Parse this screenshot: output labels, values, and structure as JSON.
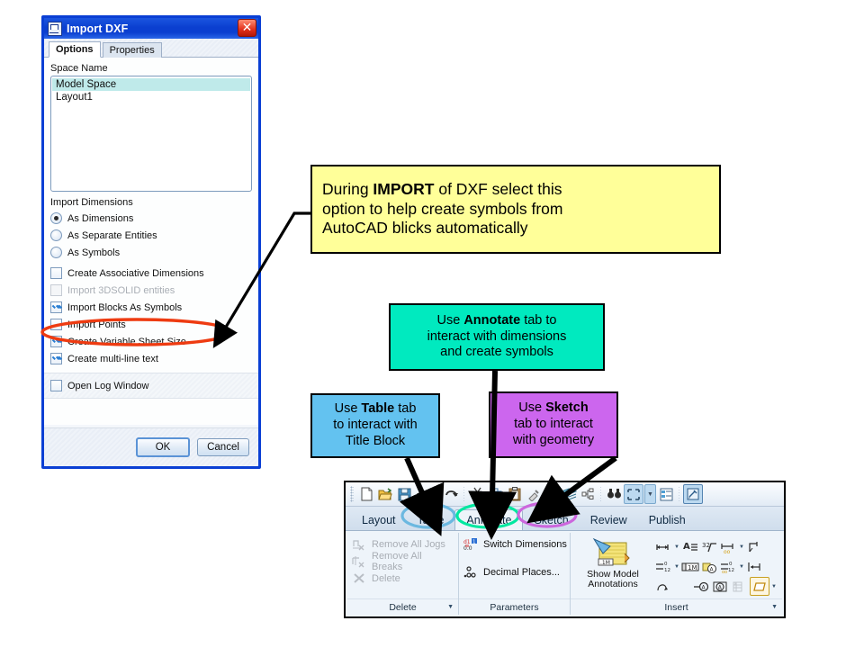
{
  "dialog": {
    "title": "Import DXF",
    "title_icon": "import-dxf-icon",
    "close_label": "✕",
    "tabs": [
      {
        "label": "Options",
        "active": true
      },
      {
        "label": "Properties",
        "active": false
      }
    ],
    "space_name_label": "Space Name",
    "space_list": [
      {
        "label": "Model Space",
        "selected": true
      },
      {
        "label": "Layout1",
        "selected": false
      }
    ],
    "import_dimensions_label": "Import Dimensions",
    "radios": [
      {
        "label": "As Dimensions",
        "checked": true
      },
      {
        "label": "As Separate Entities",
        "checked": false
      },
      {
        "label": "As Symbols",
        "checked": false
      }
    ],
    "checkboxes": [
      {
        "label": "Create Associative Dimensions",
        "checked": false,
        "disabled": false
      },
      {
        "label": "Import 3DSOLID entities",
        "checked": false,
        "disabled": true
      },
      {
        "label": "Import Blocks As Symbols",
        "checked": true,
        "disabled": false
      },
      {
        "label": "Import Points",
        "checked": false,
        "disabled": false
      },
      {
        "label": "Create Variable Sheet Size",
        "checked": true,
        "disabled": false
      },
      {
        "label": "Create multi-line text",
        "checked": true,
        "disabled": false
      }
    ],
    "log_checkbox": {
      "label": "Open Log Window",
      "checked": false
    },
    "buttons": [
      {
        "label": "OK",
        "default": true
      },
      {
        "label": "Cancel",
        "default": false
      }
    ]
  },
  "callouts": {
    "yellow": {
      "color": "#ffff99",
      "lines": [
        {
          "pre": "During ",
          "bold": "IMPORT",
          "post": " of DXF select this"
        },
        {
          "pre": "option to help create symbols from",
          "bold": "",
          "post": ""
        },
        {
          "pre": "AutoCAD blicks automatically",
          "bold": "",
          "post": ""
        }
      ]
    },
    "green": {
      "color": "#00eabf",
      "lines": [
        {
          "pre": "Use ",
          "bold": "Annotate",
          "post": " tab to"
        },
        {
          "pre": "interact with dimensions",
          "bold": "",
          "post": ""
        },
        {
          "pre": "and create symbols",
          "bold": "",
          "post": ""
        }
      ]
    },
    "blue": {
      "color": "#63c2f0",
      "lines": [
        {
          "pre": "Use ",
          "bold": "Table",
          "post": " tab"
        },
        {
          "pre": "to interact with",
          "bold": "",
          "post": ""
        },
        {
          "pre": "Title Block",
          "bold": "",
          "post": ""
        }
      ]
    },
    "purple": {
      "color": "#cc66ee",
      "lines": [
        {
          "pre": "Use ",
          "bold": "Sketch",
          "post": ""
        },
        {
          "pre": "tab to interact",
          "bold": "",
          "post": ""
        },
        {
          "pre": "with geometry",
          "bold": "",
          "post": ""
        }
      ]
    }
  },
  "highlights": {
    "red_ellipse_color": "#ee3b11",
    "table_ellipse_color": "#6bb8e0",
    "annotate_ellipse_color": "#00e8a0",
    "sketch_ellipse_color": "#cc66dd"
  },
  "ribbon": {
    "quick_access_icons": [
      "new-document-icon",
      "open-folder-icon",
      "save-icon",
      "undo-icon",
      "redo-icon",
      "cut-icon",
      "copy-icon",
      "paste-icon",
      "format-painter-icon",
      "layers-icon",
      "tree-icon",
      "find-icon",
      "select-box-icon",
      "properties-icon",
      "options-icon"
    ],
    "tabs": [
      {
        "label": "Layout",
        "active": false
      },
      {
        "label": "Table",
        "active": false
      },
      {
        "label": "Annotate",
        "active": true
      },
      {
        "label": "Sketch",
        "active": false
      },
      {
        "label": "Review",
        "active": false
      },
      {
        "label": "Publish",
        "active": false
      }
    ],
    "panels": [
      {
        "name": "Delete",
        "title": "Delete",
        "has_dropdown": true,
        "items": [
          {
            "label": "Remove All Jogs",
            "icon": "remove-jogs-icon",
            "disabled": true
          },
          {
            "label": "Remove All Breaks",
            "icon": "remove-breaks-icon",
            "disabled": true
          },
          {
            "label": "Delete",
            "icon": "delete-x-icon",
            "disabled": true
          }
        ]
      },
      {
        "name": "Parameters",
        "title": "Parameters",
        "has_dropdown": false,
        "items": [
          {
            "label": "Switch Dimensions",
            "icon": "switch-dimensions-icon",
            "disabled": false
          },
          {
            "label": "Decimal Places...",
            "icon": "decimal-places-icon",
            "disabled": false
          }
        ]
      },
      {
        "name": "Insert",
        "title": "Insert",
        "has_dropdown": true,
        "big_button": {
          "label_line1": "Show Model",
          "label_line2": "Annotations",
          "icon": "show-model-annotations-icon"
        },
        "small_icons": [
          "smart-dimension-icon",
          "note-icon",
          "surface-finish-icon",
          "auto-dimension-icon",
          "datum-feature-icon",
          "baseline-dimension-icon",
          "balloon-icon",
          "auto-balloon-icon",
          "ordinate-dimension-icon",
          "datum-target-icon",
          "revision-cloud-icon",
          "weld-symbol-icon",
          "geometric-tolerance-icon",
          "hole-callout-icon",
          "block-icon"
        ]
      }
    ]
  }
}
